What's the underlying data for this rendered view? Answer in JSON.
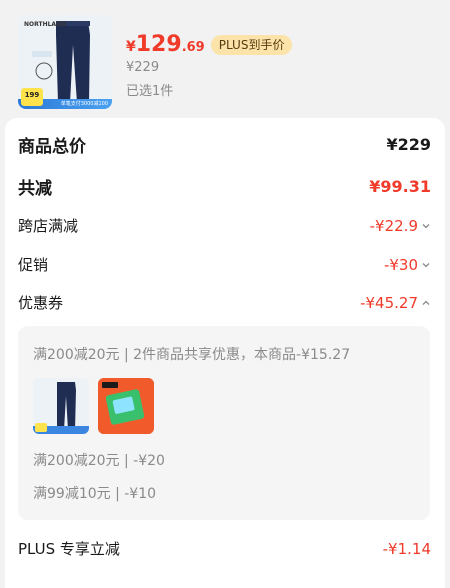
{
  "product": {
    "price_symbol": "¥",
    "price_int": "129",
    "price_dec": ".69",
    "plus_tag": "PLUS到手价",
    "original_price": "¥229",
    "selected": "已选1件",
    "thumb_brand": "NORTHLAND",
    "thumb_badge": "199",
    "thumb_strip": "单笔支付3000减100"
  },
  "summary": {
    "total_label": "商品总价",
    "total_value": "¥229",
    "reduce_label": "共减",
    "reduce_value": "¥99.31",
    "cross_store_label": "跨店满减",
    "cross_store_value": "-¥22.9",
    "promo_label": "促销",
    "promo_value": "-¥30",
    "coupon_label": "优惠券",
    "coupon_value": "-¥45.27",
    "plus_label": "PLUS 专享立减",
    "plus_value": "-¥1.14"
  },
  "coupon_detail": {
    "line1": "满200减20元 | 2件商品共享优惠，本商品-¥15.27",
    "line2": "满200减20元 | -¥20",
    "line3": "满99减10元 | -¥10"
  },
  "colors": {
    "accent_red": "#f03a2a",
    "plus_tag_bg": "#fbe3a9"
  }
}
